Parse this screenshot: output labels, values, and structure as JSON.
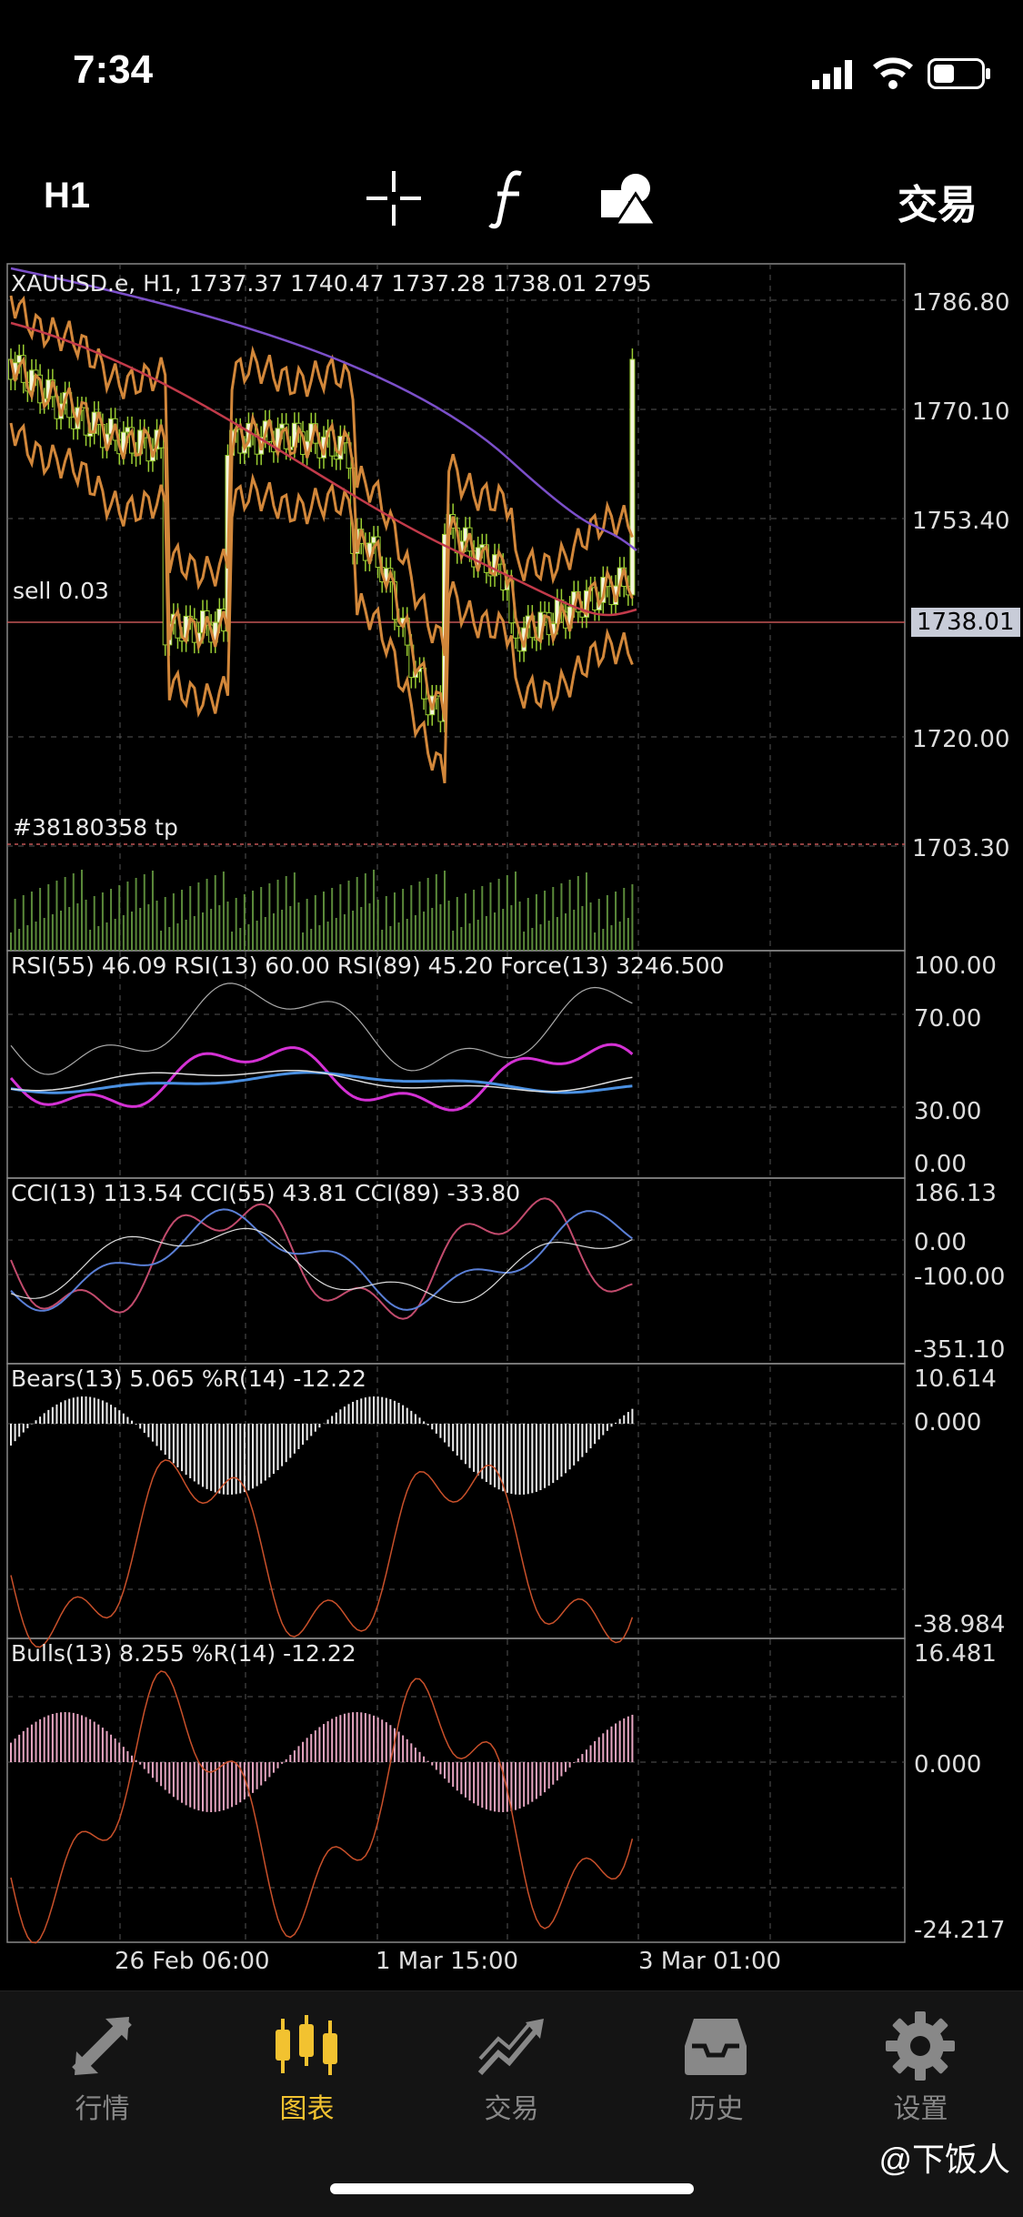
{
  "status_bar": {
    "time": "7:34"
  },
  "toolbar": {
    "period": "H1",
    "trade_label": "交易",
    "icons": [
      "crosshair-icon",
      "function-icon",
      "shapes-icon"
    ]
  },
  "chart": {
    "header": "XAUUSD.e, H1, 1737.37 1740.47 1737.28 1738.01 2795",
    "price_axis": [
      "1786.80",
      "1770.10",
      "1753.40",
      "1720.00",
      "1703.30"
    ],
    "current_price": "1738.01",
    "order_sell_label": "sell 0.03",
    "order_tp_label": "#38180358 tp",
    "time_axis": [
      "26 Feb 06:00",
      "1 Mar 15:00",
      "3 Mar 01:00"
    ],
    "colors": {
      "bull": "#f5f5dc",
      "bear": "#000000",
      "candle_border": "#9acd32",
      "bands": "#d2873a",
      "ma_red": "#c23a4a",
      "ma_purple": "#7b4fc9"
    }
  },
  "rsi_panel": {
    "header": "RSI(55) 46.09 RSI(13) 60.00 RSI(89) 45.20 Force(13) 3246.500",
    "axis": [
      "100.00",
      "70.00",
      "30.00",
      "0.00"
    ]
  },
  "cci_panel": {
    "header": "CCI(13) 113.54 CCI(55) 43.81 CCI(89) -33.80",
    "axis": [
      "186.13",
      "0.00",
      "-100.00",
      "-351.10"
    ]
  },
  "bears_panel": {
    "header": "Bears(13) 5.065 %R(14) -12.22",
    "axis": [
      "10.614",
      "0.000",
      "-38.984"
    ]
  },
  "bulls_panel": {
    "header": "Bulls(13) 8.255 %R(14) -12.22",
    "axis": [
      "16.481",
      "0.000",
      "-24.217"
    ]
  },
  "tabbar": {
    "tabs": [
      {
        "label": "行情",
        "icon": "quotes-icon",
        "active": false
      },
      {
        "label": "图表",
        "icon": "chart-icon",
        "active": true
      },
      {
        "label": "交易",
        "icon": "trade-icon",
        "active": false
      },
      {
        "label": "历史",
        "icon": "history-icon",
        "active": false
      },
      {
        "label": "设置",
        "icon": "settings-icon",
        "active": false
      }
    ]
  },
  "watermark": "@下饭人"
}
